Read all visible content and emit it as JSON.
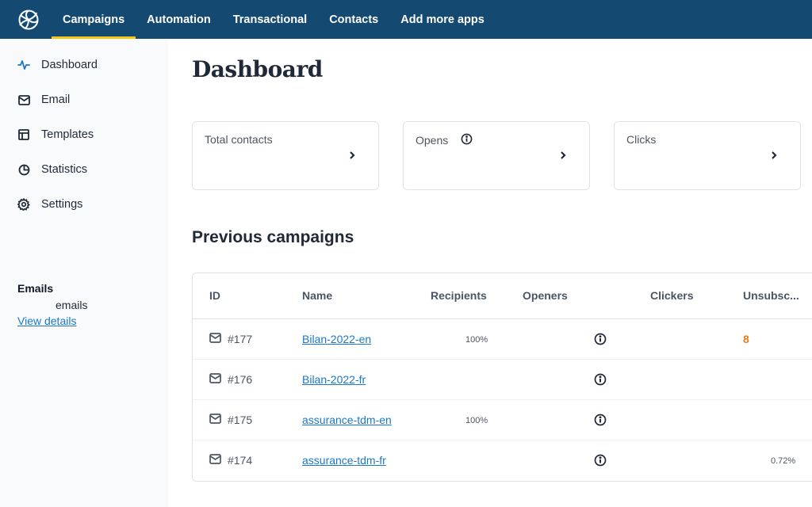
{
  "topbar": {
    "logo_icon": "sendinblue-swirl-logo",
    "nav": [
      {
        "label": "Campaigns",
        "active": true
      },
      {
        "label": "Automation",
        "active": false
      },
      {
        "label": "Transactional",
        "active": false
      },
      {
        "label": "Contacts",
        "active": false
      },
      {
        "label": "Add more apps",
        "active": false
      }
    ],
    "accent_color": "#f5c518",
    "bg_color": "#144a72"
  },
  "sidebar": {
    "items": [
      {
        "label": "Dashboard",
        "icon": "activity-pulse-icon",
        "active": true
      },
      {
        "label": "Email",
        "icon": "envelope-icon"
      },
      {
        "label": "Templates",
        "icon": "layout-icon"
      },
      {
        "label": "Statistics",
        "icon": "pie-chart-icon"
      },
      {
        "label": "Settings",
        "icon": "gear-icon"
      }
    ],
    "emails": {
      "title": "Emails",
      "count_text": "emails",
      "link": "View details"
    }
  },
  "main": {
    "title": "Dashboard",
    "cards": [
      {
        "label": "Total contacts",
        "has_info": false
      },
      {
        "label": "Opens",
        "has_info": true
      },
      {
        "label": "Clicks",
        "has_info": false
      }
    ],
    "section_title": "Previous campaigns",
    "table": {
      "columns": [
        "ID",
        "Name",
        "Recipients",
        "Openers",
        "Clickers",
        "Unsubsc..."
      ],
      "rows": [
        {
          "id": "#177",
          "name": "Bilan-2022-en",
          "recipients": "100%",
          "openers": "",
          "clickers": "",
          "unsubscribed": "8"
        },
        {
          "id": "#176",
          "name": "Bilan-2022-fr",
          "recipients": "",
          "openers": "",
          "clickers": "",
          "unsubscribed": ""
        },
        {
          "id": "#175",
          "name": "assurance-tdm-en",
          "recipients": "100%",
          "openers": "",
          "clickers": "",
          "unsubscribed": ""
        },
        {
          "id": "#174",
          "name": "assurance-tdm-fr",
          "recipients": "",
          "openers": "",
          "clickers": "",
          "unsubscribed": "0.72%"
        }
      ]
    },
    "link_color": "#1b78c8",
    "warning_color": "#e07b1a"
  }
}
